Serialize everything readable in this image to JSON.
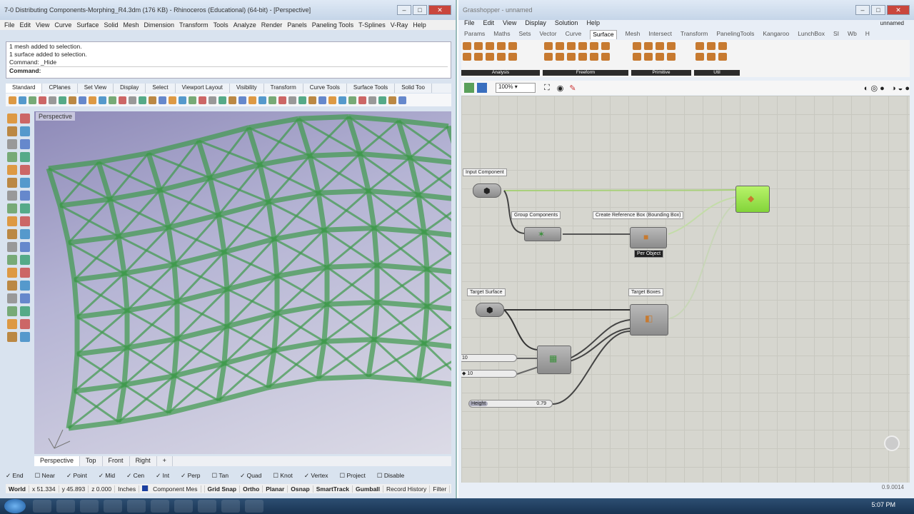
{
  "rhino": {
    "title": "7-0 Distributing Components-Morphing_R4.3dm (176 KB) - Rhinoceros (Educational) (64-bit) - [Perspective]",
    "menu": [
      "File",
      "Edit",
      "View",
      "Curve",
      "Surface",
      "Solid",
      "Mesh",
      "Dimension",
      "Transform",
      "Tools",
      "Analyze",
      "Render",
      "Panels",
      "Paneling Tools",
      "T-Splines",
      "V-Ray",
      "Help"
    ],
    "history": [
      "1 mesh added to selection.",
      "1 surface added to selection.",
      "Command: _Hide"
    ],
    "command_label": "Command:",
    "toolbar_tabs": [
      "Standard",
      "CPlanes",
      "Set View",
      "Display",
      "Select",
      "Viewport Layout",
      "Visibility",
      "Transform",
      "Curve Tools",
      "Surface Tools",
      "Solid Too"
    ],
    "viewport_label": "Perspective",
    "viewport_tabs": [
      "Perspective",
      "Top",
      "Front",
      "Right",
      "+"
    ],
    "osnaps": [
      "End",
      "Near",
      "Point",
      "Mid",
      "Cen",
      "Int",
      "Perp",
      "Tan",
      "Quad",
      "Knot",
      "Vertex",
      "Project",
      "Disable"
    ],
    "status": [
      "World",
      "x 51.334",
      "y 45.893",
      "z 0.000",
      "Inches",
      "Component Mes",
      "Grid Snap",
      "Ortho",
      "Planar",
      "Osnap",
      "SmartTrack",
      "Gumball",
      "Record History",
      "Filter"
    ]
  },
  "grasshopper": {
    "title": "Grasshopper - unnamed",
    "doc_name": "unnamed",
    "menu": [
      "File",
      "Edit",
      "View",
      "Display",
      "Solution",
      "Help"
    ],
    "tabs": [
      "Params",
      "Maths",
      "Sets",
      "Vector",
      "Curve",
      "Surface",
      "Mesh",
      "Intersect",
      "Transform",
      "PanelingTools",
      "Kangaroo",
      "LunchBox",
      "SI",
      "Wb",
      "H"
    ],
    "active_tab": "Surface",
    "ribbon_groups": [
      "Analysis",
      "Freeform",
      "Primitive",
      "Util"
    ],
    "zoom": "100%",
    "labels": {
      "input": "Input Component",
      "group": "Group Components",
      "refbox": "Create Reference Box (Bounding Box)",
      "target_surface": "Target Surface",
      "target_boxes": "Target Boxes",
      "per_object": "Per Object"
    },
    "sliders": {
      "u": "10",
      "v": "10",
      "height": "Height",
      "height_val": "0.79"
    },
    "status": "0.9.0014"
  },
  "taskbar": {
    "clock": "5:07 PM"
  }
}
